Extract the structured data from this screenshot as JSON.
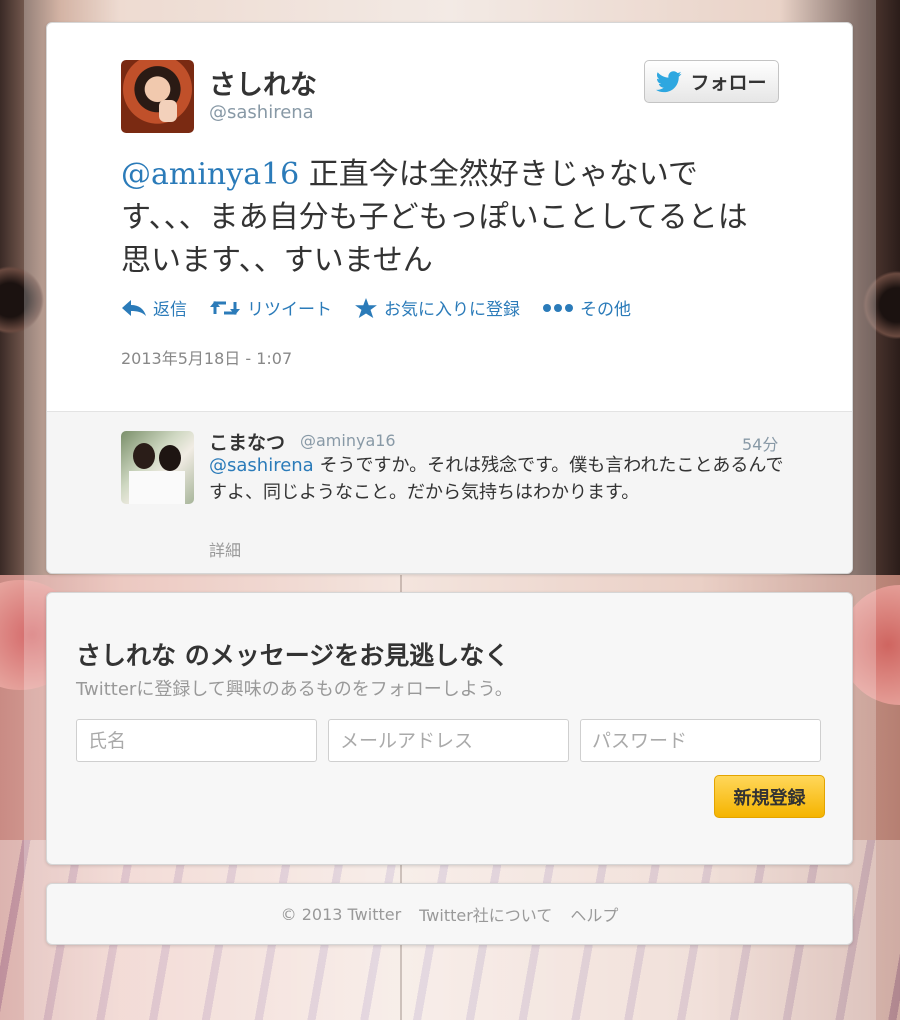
{
  "tweet": {
    "user_name": "さしれな",
    "user_handle": "@sashirena",
    "follow_label": "フォロー",
    "mention": "@aminya16",
    "text": " 正直今は全然好きじゃないです、、、まあ自分も子どもっぽいことしてるとは思います、、すいません",
    "actions": {
      "reply": "返信",
      "retweet": "リツイート",
      "favorite": "お気に入りに登録",
      "more": "その他"
    },
    "timestamp": "2013年5月18日 - 1:07"
  },
  "reply": {
    "user_name": "こまなつ",
    "user_handle": "@aminya16",
    "time": "54分",
    "mention": "@sashirena",
    "text": " そうですか。それは残念です。僕も言われたことあるんですよ、同じようなこと。だから気持ちはわかります。",
    "detail": "詳細"
  },
  "signup": {
    "title": "さしれな のメッセージをお見逃しなく",
    "subtitle": "Twitterに登録して興味のあるものをフォローしよう。",
    "name_placeholder": "氏名",
    "email_placeholder": "メールアドレス",
    "password_placeholder": "パスワード",
    "button": "新規登録"
  },
  "footer": {
    "copyright": "© 2013 Twitter",
    "about": "Twitter社について",
    "help": "ヘルプ"
  },
  "colors": {
    "link": "#2b7bb9",
    "signup_button": "#f5b400"
  }
}
